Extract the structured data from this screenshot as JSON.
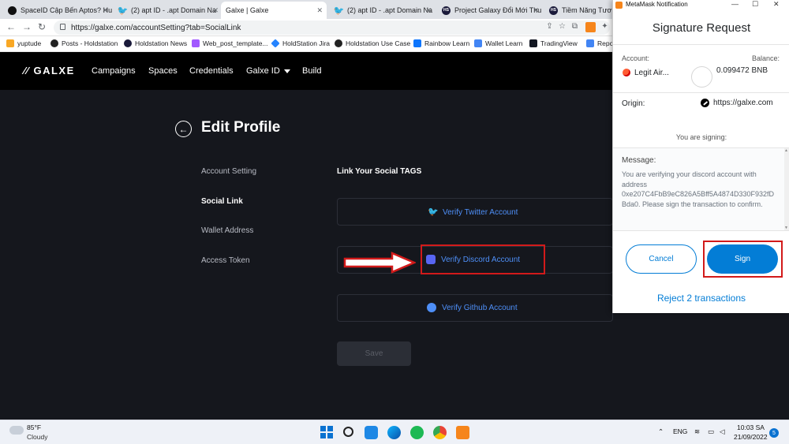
{
  "browser": {
    "tabs": [
      {
        "title": "SpaceID Cập Bến Aptos? Hu",
        "favicon": "spaceid-icon"
      },
      {
        "title": "(2) apt ID - .apt Domain Na",
        "favicon": "twitter-icon"
      },
      {
        "title": "Galxe | Galxe",
        "favicon": "galxe-icon"
      },
      {
        "title": "(2) apt ID - .apt Domain Na",
        "favicon": "twitter-icon"
      },
      {
        "title": "Project Galaxy Đổi Mới Thu",
        "favicon": "holdstation-icon"
      },
      {
        "title": "Tiềm Năng Tương",
        "favicon": "holdstation-icon"
      }
    ],
    "url": "https://galxe.com/accountSetting?tab=SocialLink",
    "bookmarks": [
      {
        "label": "yuptude",
        "color": "#f9a825"
      },
      {
        "label": "Posts - Holdstation",
        "color": "#222222"
      },
      {
        "label": "Holdstation News",
        "color": "#1a1a3a"
      },
      {
        "label": "Web_post_template...",
        "color": "#a259ff"
      },
      {
        "label": "HoldStation Jira",
        "color": "#2684ff"
      },
      {
        "label": "Holdstation Use Case",
        "color": "#222222"
      },
      {
        "label": "Rainbow Learn",
        "color": "#0e76fd"
      },
      {
        "label": "Wallet Learn",
        "color": "#4285f4"
      },
      {
        "label": "TradingView",
        "color": "#131722"
      },
      {
        "label": "Repo",
        "color": "#4285f4"
      }
    ]
  },
  "galxe": {
    "logo": "GALXE",
    "nav": [
      "Campaigns",
      "Spaces",
      "Credentials",
      "Galxe ID",
      "Build"
    ],
    "page_title": "Edit Profile",
    "sidebar": [
      "Account Setting",
      "Social Link",
      "Wallet Address",
      "Access Token"
    ],
    "section_title": "Link Your Social TAGS",
    "verify_twitter": "Verify Twitter Account",
    "verify_discord": "Verify Discord Account",
    "verify_github": "Verify Github Account",
    "save": "Save"
  },
  "metamask": {
    "window_title": "MetaMask Notification",
    "header": "Signature Request",
    "account_label": "Account:",
    "account_name": "Legit Air...",
    "balance_label": "Balance:",
    "balance": "0.099472 BNB",
    "origin_label": "Origin:",
    "origin": "https://galxe.com",
    "signing": "You are signing:",
    "message_label": "Message:",
    "message": "You are verifying your discord account with address 0xe207C4FbB9eC826A5Bff5A4874D330F932fDBda0. Please sign the transaction to confirm.",
    "cancel": "Cancel",
    "sign": "Sign",
    "reject": "Reject 2 transactions"
  },
  "taskbar": {
    "temp": "85°F",
    "weather": "Cloudy",
    "lang": "ENG",
    "time": "10:03 SA",
    "date": "21/09/2022",
    "notifications": "5"
  },
  "colors": {
    "galxe_bg": "#15171d",
    "accent_blue": "#4e8ff7",
    "metamask_blue": "#037dd6",
    "highlight_red": "#d21a1a"
  }
}
